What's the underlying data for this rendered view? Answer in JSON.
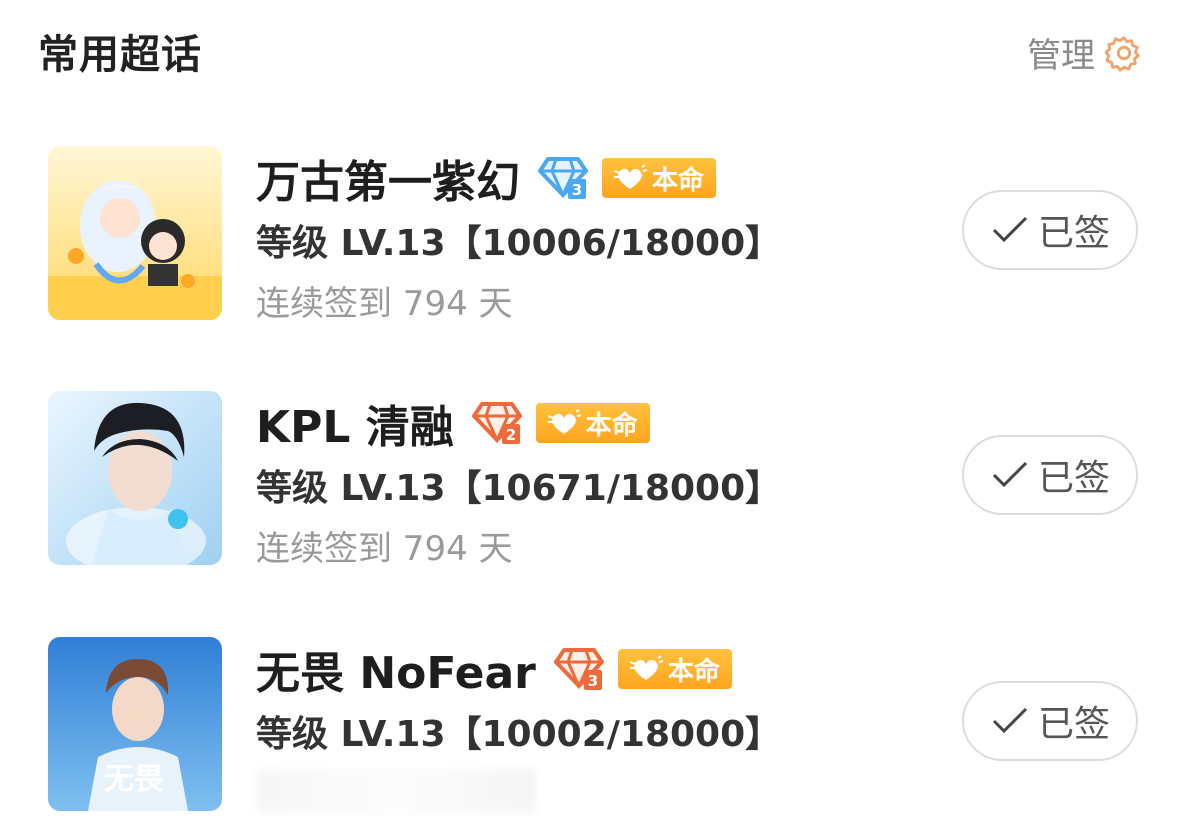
{
  "header": {
    "title": "常用超话",
    "manage_label": "管理",
    "manage_icon": "gear-icon",
    "accent_color": "#f0a36a"
  },
  "items": [
    {
      "name": "万古第一紫幻",
      "diamond_icon": "blue-diamond-level-3-icon",
      "diamond_color": "#4aa7f0",
      "diamond_level": "3",
      "fate_label": "本命",
      "level_text": "等级 LV.13【10006/18000】",
      "streak_text": "连续签到 794 天",
      "button_label": "已签"
    },
    {
      "name": "KPL 清融",
      "diamond_icon": "orange-diamond-level-2-icon",
      "diamond_color": "#ef6a3a",
      "diamond_level": "2",
      "fate_label": "本命",
      "level_text": "等级 LV.13【10671/18000】",
      "streak_text": "连续签到 794 天",
      "button_label": "已签"
    },
    {
      "name": "无畏 NoFear",
      "diamond_icon": "orange-diamond-level-3-icon",
      "diamond_color": "#ef6a3a",
      "diamond_level": "3",
      "fate_label": "本命",
      "level_text": "等级 LV.13【10002/18000】",
      "avatar_caption": "无畏",
      "button_label": "已签"
    }
  ]
}
